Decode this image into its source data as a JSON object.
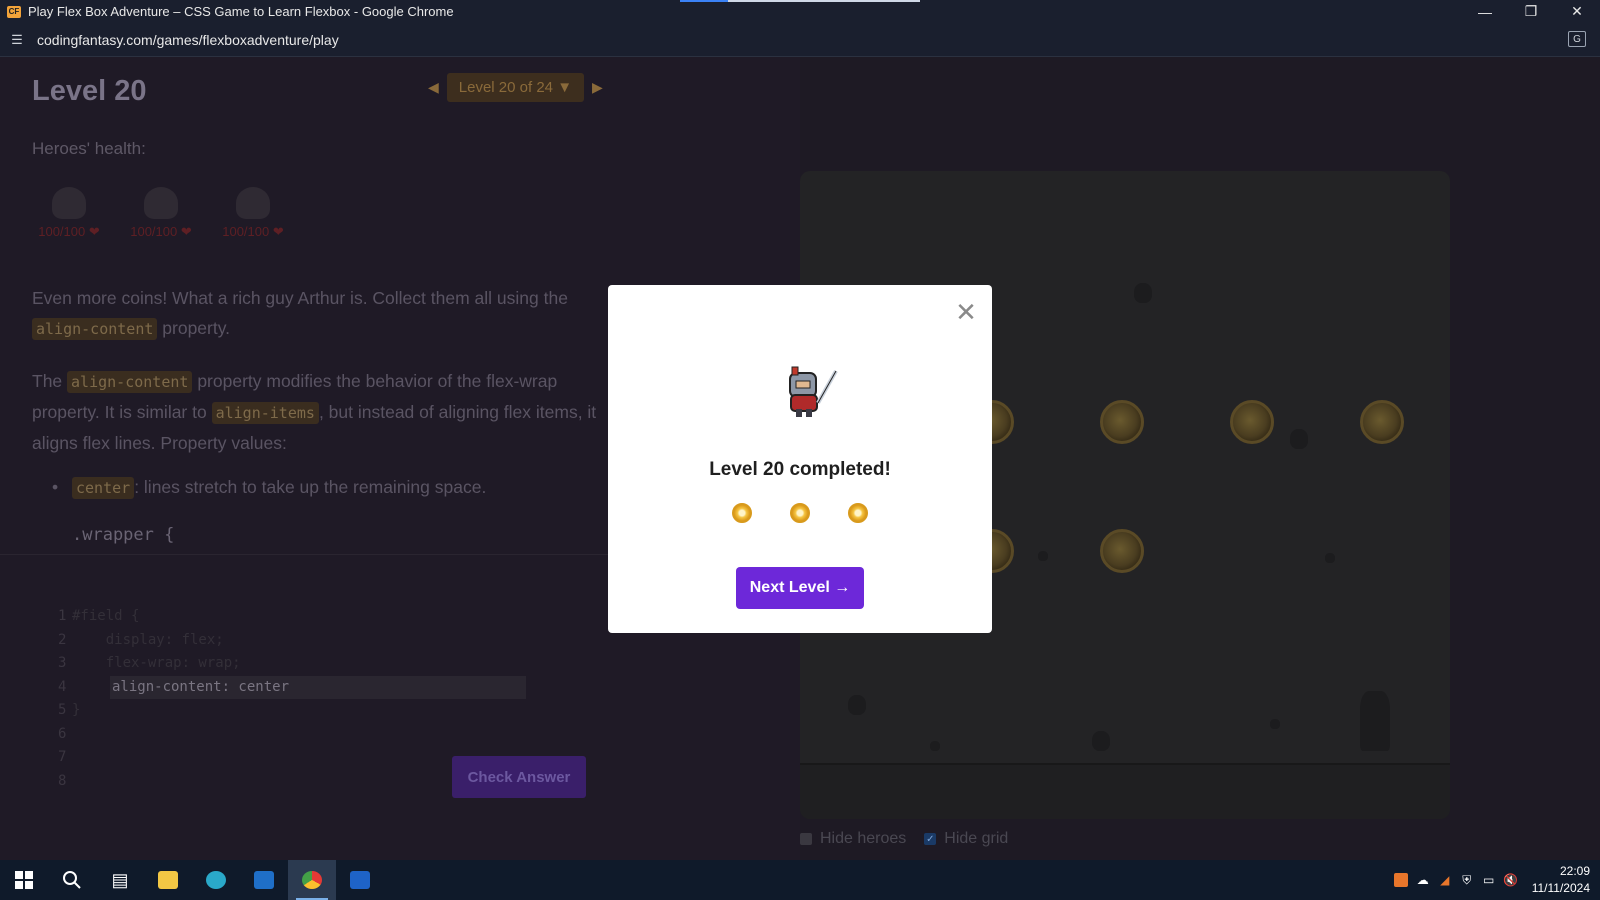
{
  "window": {
    "title": "Play Flex Box Adventure – CSS Game to Learn Flexbox - Google Chrome",
    "url": "codingfantasy.com/games/flexboxadventure/play"
  },
  "level": {
    "title": "Level 20",
    "selector": "Level 20 of 24 ▼",
    "health_label": "Heroes' health:",
    "heroes": [
      {
        "hp": "100/100"
      },
      {
        "hp": "100/100"
      },
      {
        "hp": "100/100"
      }
    ],
    "desc1_a": "Even more coins! What a rich guy Arthur is. Collect them all using the",
    "desc1_code": "align-content",
    "desc1_b": "property.",
    "desc2_a": "The",
    "desc2_code1": "align-content",
    "desc2_b": "property modifies the behavior of the flex-wrap property. It is similar to",
    "desc2_code2": "align-items",
    "desc2_c": ", but instead of aligning flex items, it aligns flex lines. Property values:",
    "bullet_code": "center",
    "bullet_text": ": lines stretch to take up the remaining space.",
    "snippet": ".wrapper {"
  },
  "editor": {
    "lines": [
      {
        "n": "1",
        "code": "#field {"
      },
      {
        "n": "2",
        "code": "    display: flex;"
      },
      {
        "n": "3",
        "code": "    flex-wrap: wrap;"
      },
      {
        "n": "4",
        "code": "align-content: center"
      },
      {
        "n": "5",
        "code": "}"
      },
      {
        "n": "6",
        "code": ""
      },
      {
        "n": "7",
        "code": ""
      },
      {
        "n": "8",
        "code": ""
      }
    ],
    "check_label": "Check Answer"
  },
  "options": {
    "hide_heroes": "Hide heroes",
    "hide_grid": "Hide grid"
  },
  "modal": {
    "title": "Level 20 completed!",
    "next_label": "Next Level →",
    "stars": 3
  },
  "taskbar": {
    "time": "22:09",
    "date": "11/11/2024"
  },
  "colors": {
    "accent": "#6d28d9",
    "coin": "#f5c542"
  }
}
